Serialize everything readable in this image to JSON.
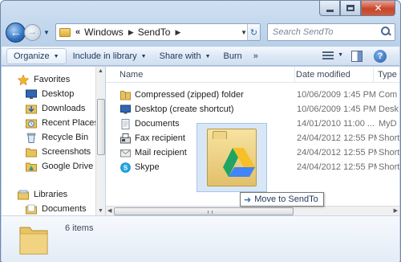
{
  "address": {
    "separator": "«",
    "crumbs": [
      "Windows",
      "SendTo"
    ]
  },
  "search": {
    "placeholder": "Search SendTo"
  },
  "commandbar": {
    "organize": "Organize",
    "include": "Include in library",
    "share": "Share with",
    "burn": "Burn",
    "more": "»"
  },
  "navpane": {
    "favorites": "Favorites",
    "desktop": "Desktop",
    "downloads": "Downloads",
    "recent": "Recent Places",
    "recycle": "Recycle Bin",
    "screenshots": "Screenshots",
    "gdrive": "Google Drive",
    "libraries": "Libraries",
    "documents": "Documents"
  },
  "columns": {
    "name": "Name",
    "date": "Date modified",
    "type": "Type"
  },
  "files": [
    {
      "name": "Compressed (zipped) folder",
      "date": "10/06/2009 1:45 PM",
      "type": "Com",
      "icon": "zip-folder"
    },
    {
      "name": "Desktop (create shortcut)",
      "date": "10/06/2009 1:45 PM",
      "type": "Desk",
      "icon": "desktop"
    },
    {
      "name": "Documents",
      "date": "14/01/2010 11:00 ...",
      "type": "MyD",
      "icon": "documents"
    },
    {
      "name": "Fax recipient",
      "date": "24/04/2012 12:55 PM",
      "type": "Short",
      "icon": "fax"
    },
    {
      "name": "Mail recipient",
      "date": "24/04/2012 12:55 PM",
      "type": "Short",
      "icon": "mail"
    },
    {
      "name": "Skype",
      "date": "24/04/2012 12:55 PM",
      "type": "Short",
      "icon": "skype"
    }
  ],
  "drag": {
    "tooltip": "Move to SendTo"
  },
  "details": {
    "count": "6 items"
  },
  "colors": {
    "accent": "#1e395b",
    "frame": "#c6d8ee",
    "folder": "#e8c463"
  }
}
